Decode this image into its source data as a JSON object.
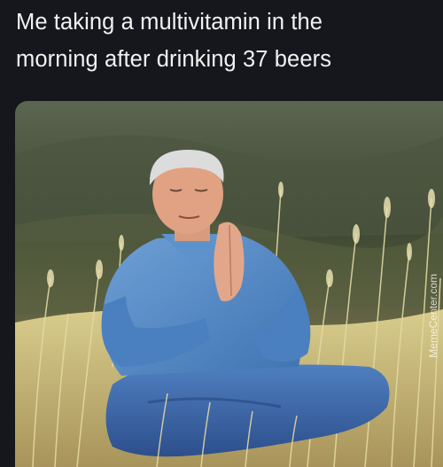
{
  "caption": {
    "line1": "Me taking a multivitamin in the",
    "line2": "morning after drinking 37 beers"
  },
  "watermark": "MemeCenter.com",
  "colors": {
    "background": "#15171c",
    "caption_text": "#f2f2f2",
    "shirt": "#4f86c4",
    "jeans": "#3b64a8",
    "grass": "#c9b86a",
    "hill": "#3f4a33"
  }
}
